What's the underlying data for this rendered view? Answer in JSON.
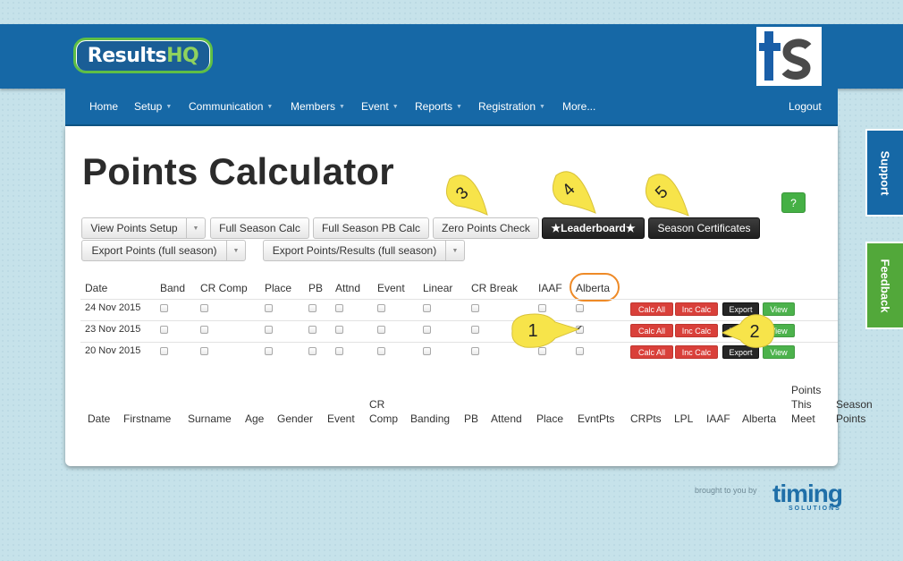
{
  "brand": {
    "part1": "Results",
    "part2": "HQ"
  },
  "nav": {
    "items": [
      {
        "label": "Home",
        "caret": false
      },
      {
        "label": "Setup",
        "caret": true
      },
      {
        "label": "Communication",
        "caret": true
      },
      {
        "label": "Members",
        "caret": true
      },
      {
        "label": "Event",
        "caret": true
      },
      {
        "label": "Reports",
        "caret": true
      },
      {
        "label": "Registration",
        "caret": true
      },
      {
        "label": "More...",
        "caret": false
      }
    ],
    "logout": "Logout"
  },
  "page": {
    "title": "Points Calculator",
    "help": "?"
  },
  "toolbar": {
    "view_points_setup": "View Points Setup",
    "full_season_calc": "Full Season Calc",
    "full_season_pb_calc": "Full Season PB Calc",
    "zero_points_check": "Zero Points Check",
    "leaderboard": "★Leaderboard★",
    "season_certificates": "Season Certificates",
    "export_points": "Export Points (full season)",
    "export_points_results": "Export Points/Results (full season)"
  },
  "callouts": [
    "1",
    "2",
    "3",
    "4",
    "5"
  ],
  "events_table": {
    "headers": [
      "Date",
      "Band",
      "CR Comp",
      "Place",
      "PB",
      "Attnd",
      "Event",
      "Linear",
      "CR Break",
      "IAAF",
      "Alberta"
    ],
    "rows": [
      {
        "date": "24 Nov 2015",
        "alberta_checked": false
      },
      {
        "date": "23 Nov 2015",
        "alberta_checked": true
      },
      {
        "date": "20 Nov 2015",
        "alberta_checked": false
      }
    ],
    "actions": {
      "calc_all": "Calc All",
      "inc_calc": "Inc Calc",
      "export": "Export",
      "view": "View"
    }
  },
  "results_table": {
    "headers": [
      "Date",
      "Firstname",
      "Surname",
      "Age",
      "Gender",
      "Event",
      "CR Comp",
      "Banding",
      "PB",
      "Attend",
      "Place",
      "EvntPts",
      "CRPts",
      "LPL",
      "IAAF",
      "Alberta",
      "Points This Meet",
      "Season Points"
    ]
  },
  "side_tabs": {
    "support": "Support",
    "feedback": "Feedback"
  },
  "footer": {
    "brought_by": "brought to you by",
    "logo_main": "timing",
    "logo_sub": "SOLUTIONS"
  },
  "colors": {
    "brand_blue": "#1668a6",
    "accent_green": "#5fbf45",
    "danger_red": "#d9403a",
    "callout_yellow": "#f7e44a",
    "highlight_orange": "#ee8a27"
  }
}
